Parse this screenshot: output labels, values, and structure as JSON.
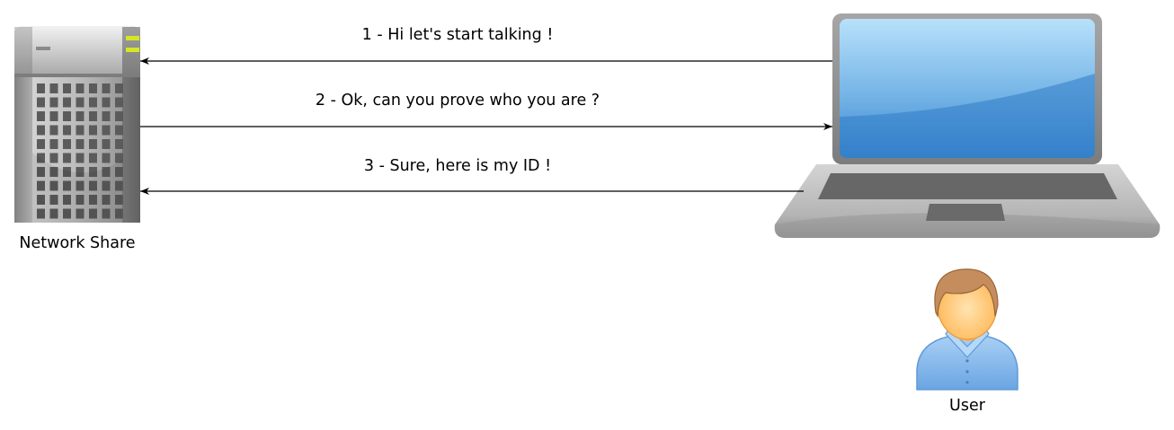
{
  "nodes": {
    "server": {
      "label": "Network Share",
      "icon": "server-icon"
    },
    "laptop": {
      "icon": "laptop-icon"
    },
    "user": {
      "label": "User",
      "icon": "user-icon"
    }
  },
  "messages": [
    {
      "label": "1 - Hi let's start talking !",
      "from": "laptop",
      "to": "server"
    },
    {
      "label": "2 - Ok, can you prove who you are ?",
      "from": "server",
      "to": "laptop"
    },
    {
      "label": "3 - Sure, here is my ID !",
      "from": "laptop",
      "to": "server"
    }
  ],
  "colors": {
    "line": "#000000",
    "screen": "#4a90d6",
    "server_body": "#a0a0a0",
    "server_led": "#d6e625",
    "user_shirt": "#86b7ea",
    "user_skin": "#ffc76e",
    "user_hair": "#c58d5e"
  }
}
